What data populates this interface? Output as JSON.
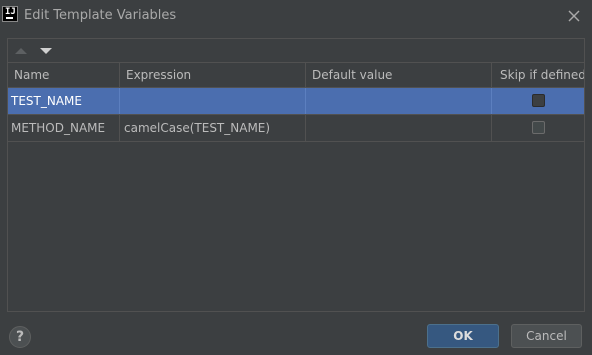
{
  "window": {
    "title": "Edit Template Variables",
    "app_icon_glyph": "IJ",
    "app_icon": "intellij-icon",
    "close_icon": "close-icon"
  },
  "toolbar": {
    "move_up_icon": "triangle-up-icon",
    "move_down_icon": "triangle-down-icon"
  },
  "table": {
    "columns": [
      "Name",
      "Expression",
      "Default value",
      "Skip if defined"
    ],
    "rows": [
      {
        "name": "TEST_NAME",
        "expression": "",
        "default_value": "",
        "skip_if_defined": false,
        "selected": true
      },
      {
        "name": "METHOD_NAME",
        "expression": "camelCase(TEST_NAME)",
        "default_value": "",
        "skip_if_defined": false,
        "selected": false
      }
    ]
  },
  "footer": {
    "help_label": "?",
    "ok_label": "OK",
    "cancel_label": "Cancel"
  },
  "colors": {
    "background": "#3c3f41",
    "selection": "#4b6eaf",
    "ok_button": "#365880"
  }
}
